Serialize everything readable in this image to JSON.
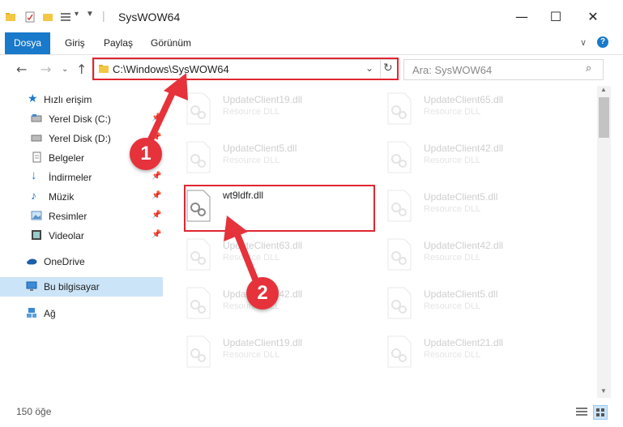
{
  "window": {
    "title": "SysWOW64",
    "controls": {
      "minimize": "—",
      "maximize": "☐",
      "close": "✕"
    }
  },
  "ribbon": {
    "tabs": [
      "Dosya",
      "Giriş",
      "Paylaş",
      "Görünüm"
    ],
    "active_tab": "Dosya",
    "accent_color": "#1979ca"
  },
  "address": {
    "path": "C:\\Windows\\SysWOW64",
    "search_placeholder": "Ara: SysWOW64"
  },
  "navigation": {
    "items": [
      {
        "label": "Hızlı erişim",
        "icon": "star-icon",
        "pinned": false
      },
      {
        "label": "Yerel Disk (C:)",
        "icon": "drive-icon",
        "pinned": true
      },
      {
        "label": "Yerel Disk (D:)",
        "icon": "drive-icon",
        "pinned": true
      },
      {
        "label": "Belgeler",
        "icon": "documents-icon",
        "pinned": true
      },
      {
        "label": "İndirmeler",
        "icon": "download-icon",
        "pinned": true
      },
      {
        "label": "Müzik",
        "icon": "music-icon",
        "pinned": true
      },
      {
        "label": "Resimler",
        "icon": "pictures-icon",
        "pinned": true
      },
      {
        "label": "Videolar",
        "icon": "video-icon",
        "pinned": true
      },
      {
        "label": "OneDrive",
        "icon": "cloud-icon",
        "pinned": false
      },
      {
        "label": "Bu bilgisayar",
        "icon": "computer-icon",
        "pinned": false,
        "selected": true
      },
      {
        "label": "Ağ",
        "icon": "network-icon",
        "pinned": false
      }
    ]
  },
  "files": {
    "left_column": [
      {
        "name": "UpdateClient19.dll",
        "type": "Resource DLL",
        "faded": true
      },
      {
        "name": "UpdateClient5.dll",
        "type": "Resource DLL",
        "faded": true
      },
      {
        "name": "wt9ldfr.dll",
        "type": "",
        "faded": false
      },
      {
        "name": "UpdateClient63.dll",
        "type": "Resource DLL",
        "faded": true
      },
      {
        "name": "UpdateClient42.dll",
        "type": "Resource DLL",
        "faded": true
      },
      {
        "name": "UpdateClient19.dll",
        "type": "Resource DLL",
        "faded": true
      }
    ],
    "right_column": [
      {
        "name": "UpdateClient65.dll",
        "type": "Resource DLL",
        "faded": true
      },
      {
        "name": "UpdateClient42.dll",
        "type": "Resource DLL",
        "faded": true
      },
      {
        "name": "UpdateClient5.dll",
        "type": "Resource DLL",
        "faded": true
      },
      {
        "name": "UpdateClient42.dll",
        "type": "Resource DLL",
        "faded": true
      },
      {
        "name": "UpdateClient5.dll",
        "type": "Resource DLL",
        "faded": true
      },
      {
        "name": "UpdateClient21.dll",
        "type": "Resource DLL",
        "faded": true
      }
    ]
  },
  "status": {
    "item_count": "150 öğe"
  },
  "annotations": {
    "step1": "1",
    "step2": "2",
    "highlight_color": "#e0262f"
  }
}
